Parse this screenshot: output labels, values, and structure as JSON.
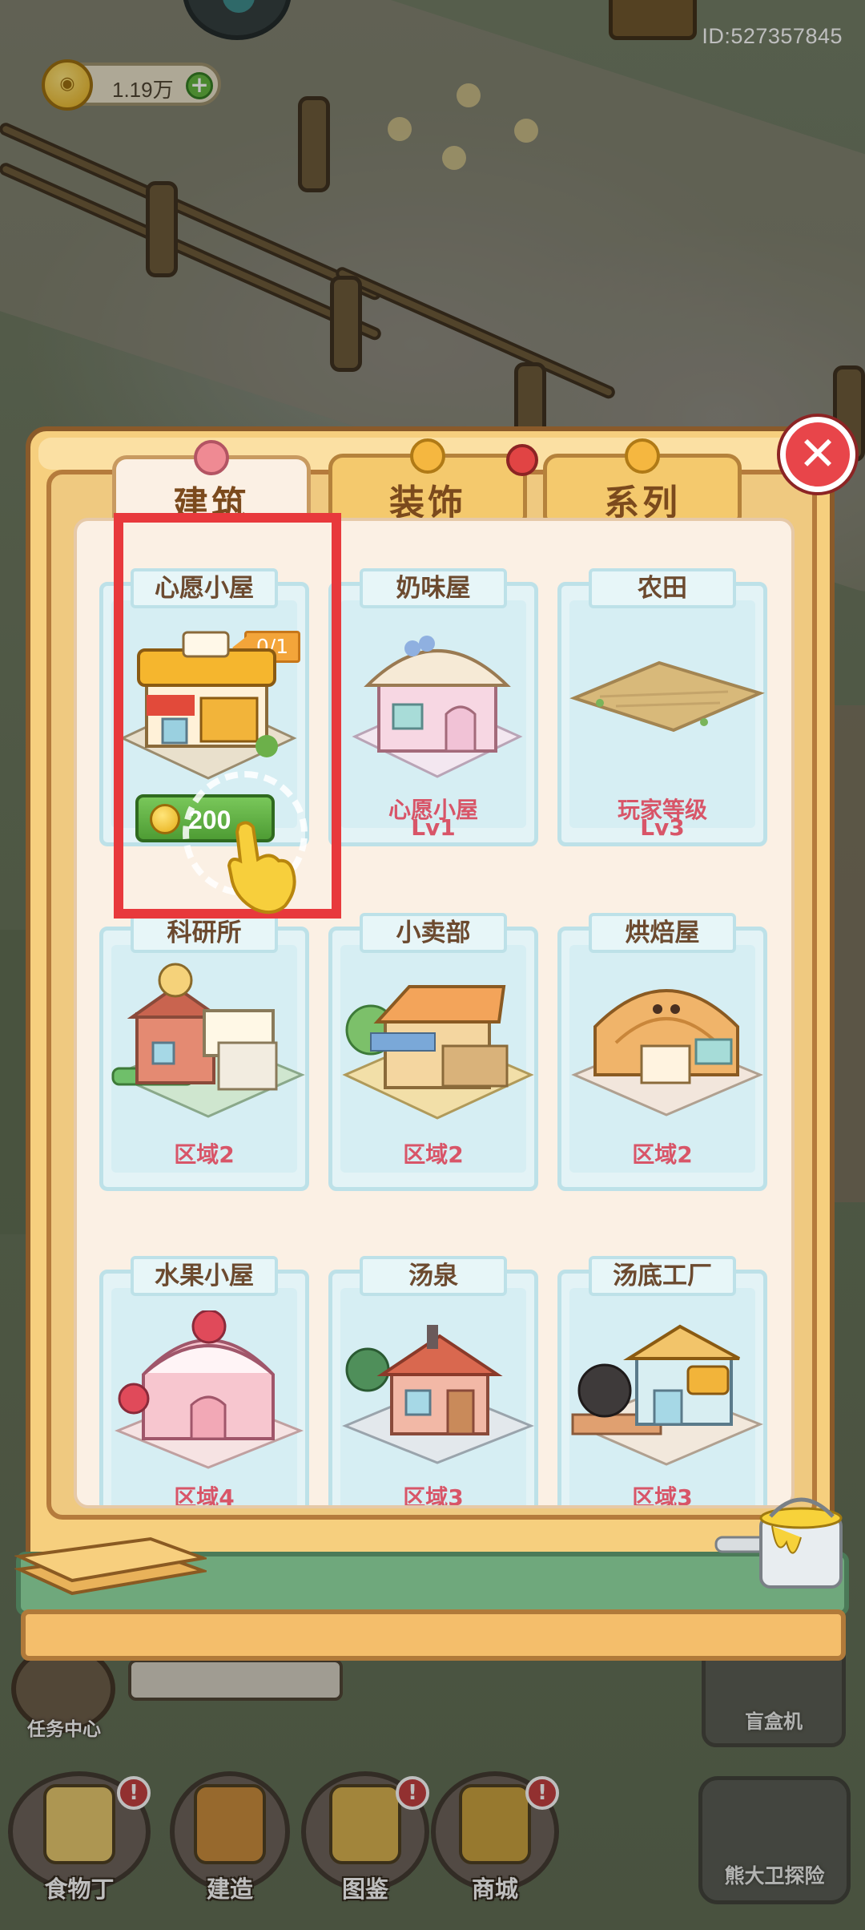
{
  "hud": {
    "coins": "1.19万",
    "user_id": "ID:527357845"
  },
  "tabs": [
    {
      "label": "建筑",
      "active": true
    },
    {
      "label": "装饰",
      "active": false
    },
    {
      "label": "系列",
      "active": false
    }
  ],
  "cards": [
    {
      "name": "心愿小屋",
      "cost_badge": "0/1",
      "price": "200",
      "req1": "",
      "req2": ""
    },
    {
      "name": "奶味屋",
      "req1": "心愿小屋",
      "req2": "Lv1"
    },
    {
      "name": "农田",
      "req1": "玩家等级",
      "req2": "Lv3"
    },
    {
      "name": "科研所",
      "req1": "区域2",
      "req2": ""
    },
    {
      "name": "小卖部",
      "req1": "区域2",
      "req2": ""
    },
    {
      "name": "烘焙屋",
      "req1": "区域2",
      "req2": ""
    },
    {
      "name": "水果小屋",
      "req1": "区域4",
      "req2": ""
    },
    {
      "name": "汤泉",
      "req1": "区域3",
      "req2": ""
    },
    {
      "name": "汤底工厂",
      "req1": "区域3",
      "req2": ""
    }
  ],
  "bottom_left": {
    "task_center": "任务中心"
  },
  "bottom_right": {
    "blind_box": "盲盒机",
    "explore": "熊大卫探险"
  },
  "dock": [
    {
      "label": "食物丁",
      "alert": "!"
    },
    {
      "label": "建造",
      "alert": ""
    },
    {
      "label": "图鉴",
      "alert": "!"
    },
    {
      "label": "商城",
      "alert": "!"
    }
  ],
  "colors": {
    "highlight": "#e8393c",
    "requirement_text": "#d85568",
    "price_button": "#4e9c34",
    "close_button": "#e8454a"
  },
  "icons": [
    "coin-icon",
    "plus-icon",
    "close-icon",
    "hand-pointer-icon",
    "paint-bucket-icon",
    "wooden-planks-icon"
  ]
}
